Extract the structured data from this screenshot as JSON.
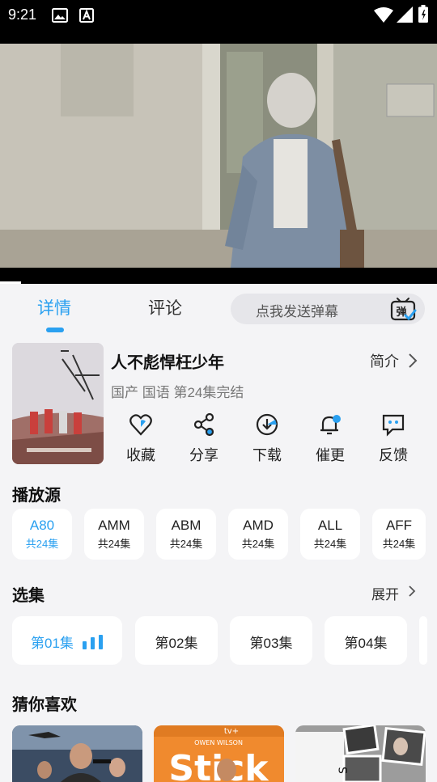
{
  "status_bar": {
    "time": "9:21"
  },
  "tabs": [
    {
      "label": "详情",
      "active": true
    },
    {
      "label": "评论",
      "active": false
    }
  ],
  "danmu": {
    "placeholder": "点我发送弹幕",
    "icon_text": "弹"
  },
  "show": {
    "title": "人不彪悍枉少年",
    "intro_label": "简介",
    "meta": "国产 国语 第24集完结"
  },
  "actions": [
    {
      "label": "收藏",
      "icon": "favorite-icon"
    },
    {
      "label": "分享",
      "icon": "share-icon"
    },
    {
      "label": "下载",
      "icon": "download-icon"
    },
    {
      "label": "催更",
      "icon": "urge-update-icon"
    },
    {
      "label": "反馈",
      "icon": "feedback-icon"
    }
  ],
  "sources": {
    "title": "播放源",
    "items": [
      {
        "code": "A80",
        "count": "共24集",
        "active": true
      },
      {
        "code": "AMM",
        "count": "共24集"
      },
      {
        "code": "ABM",
        "count": "共24集"
      },
      {
        "code": "AMD",
        "count": "共24集"
      },
      {
        "code": "ALL",
        "count": "共24集"
      },
      {
        "code": "AFF",
        "count": "共24集"
      }
    ]
  },
  "episodes": {
    "title": "选集",
    "expand_label": "展开",
    "items": [
      {
        "label": "第01集",
        "active": true
      },
      {
        "label": "第02集"
      },
      {
        "label": "第03集"
      },
      {
        "label": "第04集"
      }
    ]
  },
  "recommend": {
    "title": "猜你喜欢",
    "cards": [
      {
        "poster_text": ""
      },
      {
        "poster_text": "Stick",
        "tag": "tv+",
        "subtitle": "OWEN WILSON"
      },
      {
        "poster_text": ""
      }
    ]
  },
  "colors": {
    "accent": "#2aa0f0"
  }
}
